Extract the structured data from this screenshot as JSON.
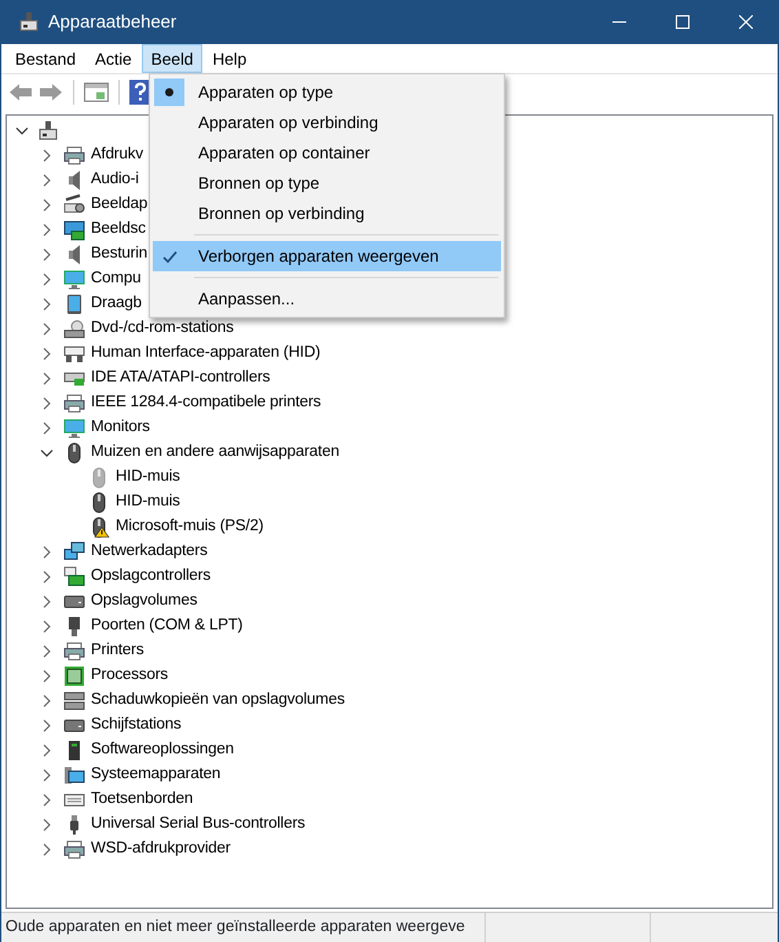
{
  "window": {
    "title": "Apparaatbeheer"
  },
  "menubar": [
    {
      "label": "Bestand",
      "selected": false
    },
    {
      "label": "Actie",
      "selected": false
    },
    {
      "label": "Beeld",
      "selected": true
    },
    {
      "label": "Help",
      "selected": false
    }
  ],
  "menu": {
    "items": [
      {
        "kind": "radio",
        "label": "Apparaten op type",
        "checked": true,
        "highlighted": false
      },
      {
        "kind": "radio",
        "label": "Apparaten op verbinding",
        "checked": false,
        "highlighted": false
      },
      {
        "kind": "radio",
        "label": "Apparaten op container",
        "checked": false,
        "highlighted": false
      },
      {
        "kind": "radio",
        "label": "Bronnen op type",
        "checked": false,
        "highlighted": false
      },
      {
        "kind": "radio",
        "label": "Bronnen op verbinding",
        "checked": false,
        "highlighted": false
      },
      {
        "kind": "separator"
      },
      {
        "kind": "check",
        "label": "Verborgen apparaten weergeven",
        "checked": true,
        "highlighted": true
      },
      {
        "kind": "separator"
      },
      {
        "kind": "command",
        "label": "Aanpassen...",
        "highlighted": false
      }
    ]
  },
  "tree": {
    "expanded": true,
    "children": [
      {
        "label": "Afdrukv",
        "expanded": false
      },
      {
        "label": "Audio-i",
        "expanded": false
      },
      {
        "label": "Beeldap",
        "expanded": false
      },
      {
        "label": "Beeldsc",
        "expanded": false
      },
      {
        "label": "Besturin",
        "expanded": false
      },
      {
        "label": "Compu",
        "expanded": false
      },
      {
        "label": "Draagb",
        "expanded": false
      },
      {
        "label": "Dvd-/cd-rom-stations",
        "expanded": false
      },
      {
        "label": "Human Interface-apparaten (HID)",
        "expanded": false
      },
      {
        "label": "IDE ATA/ATAPI-controllers",
        "expanded": false
      },
      {
        "label": "IEEE 1284.4-compatibele printers",
        "expanded": false
      },
      {
        "label": "Monitors",
        "expanded": false
      },
      {
        "label": "Muizen en andere aanwijsapparaten",
        "expanded": true,
        "children": [
          {
            "label": "HID-muis",
            "hidden": true,
            "warning": false
          },
          {
            "label": "HID-muis",
            "hidden": false,
            "warning": false
          },
          {
            "label": "Microsoft-muis (PS/2)",
            "hidden": false,
            "warning": true
          }
        ]
      },
      {
        "label": "Netwerkadapters",
        "expanded": false
      },
      {
        "label": "Opslagcontrollers",
        "expanded": false
      },
      {
        "label": "Opslagvolumes",
        "expanded": false
      },
      {
        "label": "Poorten (COM & LPT)",
        "expanded": false
      },
      {
        "label": "Printers",
        "expanded": false
      },
      {
        "label": "Processors",
        "expanded": false
      },
      {
        "label": "Schaduwkopieën van opslagvolumes",
        "expanded": false
      },
      {
        "label": "Schijfstations",
        "expanded": false
      },
      {
        "label": "Softwareoplossingen",
        "expanded": false
      },
      {
        "label": "Systeemapparaten",
        "expanded": false
      },
      {
        "label": "Toetsenborden",
        "expanded": false
      },
      {
        "label": "Universal Serial Bus-controllers",
        "expanded": false
      },
      {
        "label": "WSD-afdrukprovider",
        "expanded": false
      }
    ]
  },
  "status_bar": {
    "text": "Oude apparaten en niet meer geïnstalleerde apparaten weergeve"
  }
}
